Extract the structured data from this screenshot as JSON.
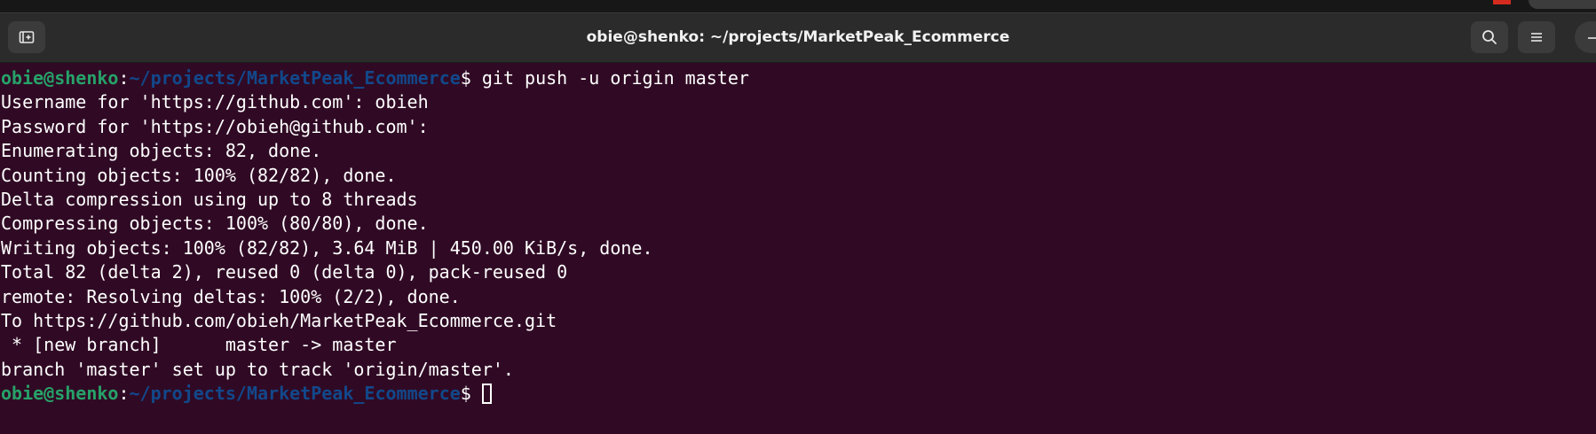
{
  "window": {
    "title": "obie@shenko: ~/projects/MarketPeak_Ecommerce"
  },
  "titlebar_buttons": [
    {
      "name": "new-tab",
      "icon": "new-tab-icon"
    },
    {
      "name": "search",
      "icon": "search-icon"
    },
    {
      "name": "menu",
      "icon": "hamburger-menu-icon"
    },
    {
      "name": "minimize",
      "icon": "minimize-icon"
    }
  ],
  "colors": {
    "terminal_bg": "#300a24",
    "prompt_user": "#26a269",
    "prompt_path": "#12488b",
    "text": "#ffffff",
    "titlebar_bg": "#2b2b2b"
  },
  "terminal": {
    "prompt": {
      "user_host": "obie@shenko",
      "colon": ":",
      "path": "~/projects/MarketPeak_Ecommerce",
      "dollar": "$ "
    },
    "command": "git push -u origin master",
    "output": [
      "Username for 'https://github.com': obieh",
      "Password for 'https://obieh@github.com':",
      "Enumerating objects: 82, done.",
      "Counting objects: 100% (82/82), done.",
      "Delta compression using up to 8 threads",
      "Compressing objects: 100% (80/80), done.",
      "Writing objects: 100% (82/82), 3.64 MiB | 450.00 KiB/s, done.",
      "Total 82 (delta 2), reused 0 (delta 0), pack-reused 0",
      "remote: Resolving deltas: 100% (2/2), done.",
      "To https://github.com/obieh/MarketPeak_Ecommerce.git",
      " * [new branch]      master -> master",
      "branch 'master' set up to track 'origin/master'."
    ]
  }
}
